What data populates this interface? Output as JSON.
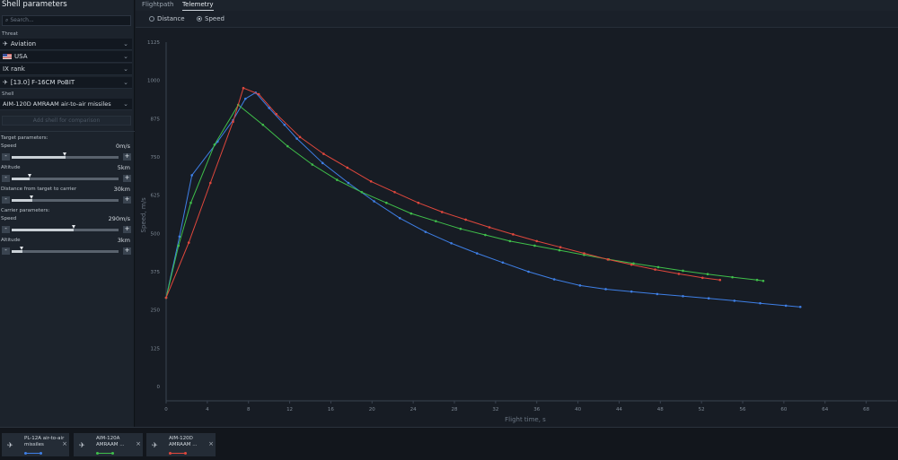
{
  "panel": {
    "title": "Shell parameters",
    "search_placeholder": "Search...",
    "threat_label": "Threat",
    "threat_type": "Aviation",
    "country": "USA",
    "rank": "IX rank",
    "vehicle": "[13.0] F-16CM PoBIT",
    "shell_label": "Shell",
    "shell": "AIM-120D AMRAAM air-to-air missiles",
    "add_button": "Add shell for comparison",
    "target_header": "Target parameters:",
    "target_speed_label": "Speed",
    "target_speed_value": "0m/s",
    "target_speed_level": 0.5,
    "target_altitude_label": "Altitude",
    "target_altitude_value": "5km",
    "target_altitude_level": 0.17,
    "distance_label": "Distance from target to carrier",
    "distance_value": "30km",
    "distance_level": 0.19,
    "carrier_header": "Carrier parameters:",
    "carrier_speed_label": "Speed",
    "carrier_speed_value": "290m/s",
    "carrier_speed_level": 0.58,
    "carrier_altitude_label": "Altitude",
    "carrier_altitude_value": "3km",
    "carrier_altitude_level": 0.1,
    "minus": "-",
    "plus": "+"
  },
  "tabs": [
    "Flightpath",
    "Telemetry"
  ],
  "active_tab": "Telemetry",
  "modes": [
    "Distance",
    "Speed"
  ],
  "active_mode": "Speed",
  "comparison": [
    {
      "name": "PL-12A air-to-air missiles",
      "color": "#3e7fe6"
    },
    {
      "name": "AIM-120A AMRAAM ...",
      "color": "#3fbf4a"
    },
    {
      "name": "AIM-120D AMRAAM ...",
      "color": "#e0473c"
    }
  ],
  "close_symbol": "×",
  "chart_data": {
    "type": "line",
    "xlabel": "Flight time, s",
    "ylabel": "Speed, m/s",
    "xlim": [
      0,
      71
    ],
    "ylim": [
      0,
      1125
    ],
    "xticks": [
      0,
      4,
      8,
      12,
      16,
      20,
      24,
      28,
      32,
      36,
      40,
      44,
      48,
      52,
      56,
      60,
      64,
      68
    ],
    "yticks": [
      0,
      125,
      250,
      375,
      500,
      625,
      750,
      875,
      1000,
      1125
    ],
    "grid": false,
    "series": [
      {
        "name": "PL-12A air-to-air missiles",
        "color": "#3e7fe6",
        "points": [
          [
            0,
            290
          ],
          [
            1.3,
            490
          ],
          [
            2.5,
            690
          ],
          [
            5,
            800
          ],
          [
            6.5,
            870
          ],
          [
            7.7,
            940
          ],
          [
            8.7,
            960
          ],
          [
            10,
            910
          ],
          [
            11.5,
            855
          ],
          [
            12.7,
            810
          ],
          [
            15.2,
            730
          ],
          [
            17.7,
            665
          ],
          [
            20.2,
            605
          ],
          [
            22.7,
            550
          ],
          [
            25.2,
            505
          ],
          [
            27.7,
            468
          ],
          [
            30.2,
            435
          ],
          [
            32.7,
            405
          ],
          [
            35.2,
            375
          ],
          [
            37.7,
            350
          ],
          [
            40.2,
            330
          ],
          [
            42.7,
            318
          ],
          [
            45.2,
            310
          ],
          [
            47.7,
            302
          ],
          [
            50.2,
            295
          ],
          [
            52.7,
            288
          ],
          [
            55.2,
            280
          ],
          [
            57.7,
            272
          ],
          [
            60.2,
            264
          ],
          [
            61.6,
            260
          ]
        ]
      },
      {
        "name": "AIM-120A AMRAAM ...",
        "color": "#3fbf4a",
        "points": [
          [
            0,
            290
          ],
          [
            1.2,
            460
          ],
          [
            2.4,
            600
          ],
          [
            4.7,
            790
          ],
          [
            7,
            920
          ],
          [
            9.4,
            855
          ],
          [
            11.8,
            785
          ],
          [
            14.2,
            725
          ],
          [
            16.6,
            675
          ],
          [
            19,
            635
          ],
          [
            21.4,
            600
          ],
          [
            23.8,
            565
          ],
          [
            26.2,
            540
          ],
          [
            28.6,
            515
          ],
          [
            31,
            495
          ],
          [
            33.4,
            475
          ],
          [
            35.8,
            460
          ],
          [
            38.2,
            445
          ],
          [
            40.6,
            430
          ],
          [
            43,
            415
          ],
          [
            45.4,
            402
          ],
          [
            47.8,
            390
          ],
          [
            50.2,
            378
          ],
          [
            52.6,
            367
          ],
          [
            55,
            357
          ],
          [
            57.4,
            348
          ],
          [
            58,
            345
          ]
        ]
      },
      {
        "name": "AIM-120D AMRAAM ...",
        "color": "#e0473c",
        "points": [
          [
            0,
            290
          ],
          [
            2.2,
            470
          ],
          [
            4.3,
            665
          ],
          [
            6.5,
            865
          ],
          [
            7.5,
            975
          ],
          [
            9,
            955
          ],
          [
            10.7,
            890
          ],
          [
            13,
            815
          ],
          [
            15.3,
            760
          ],
          [
            17.6,
            715
          ],
          [
            19.9,
            670
          ],
          [
            22.2,
            635
          ],
          [
            24.5,
            600
          ],
          [
            26.8,
            570
          ],
          [
            29.1,
            545
          ],
          [
            31.4,
            520
          ],
          [
            33.7,
            497
          ],
          [
            36,
            475
          ],
          [
            38.3,
            455
          ],
          [
            40.6,
            435
          ],
          [
            42.9,
            415
          ],
          [
            45.2,
            398
          ],
          [
            47.5,
            382
          ],
          [
            49.8,
            368
          ],
          [
            52.1,
            355
          ],
          [
            53.8,
            348
          ]
        ]
      }
    ]
  }
}
